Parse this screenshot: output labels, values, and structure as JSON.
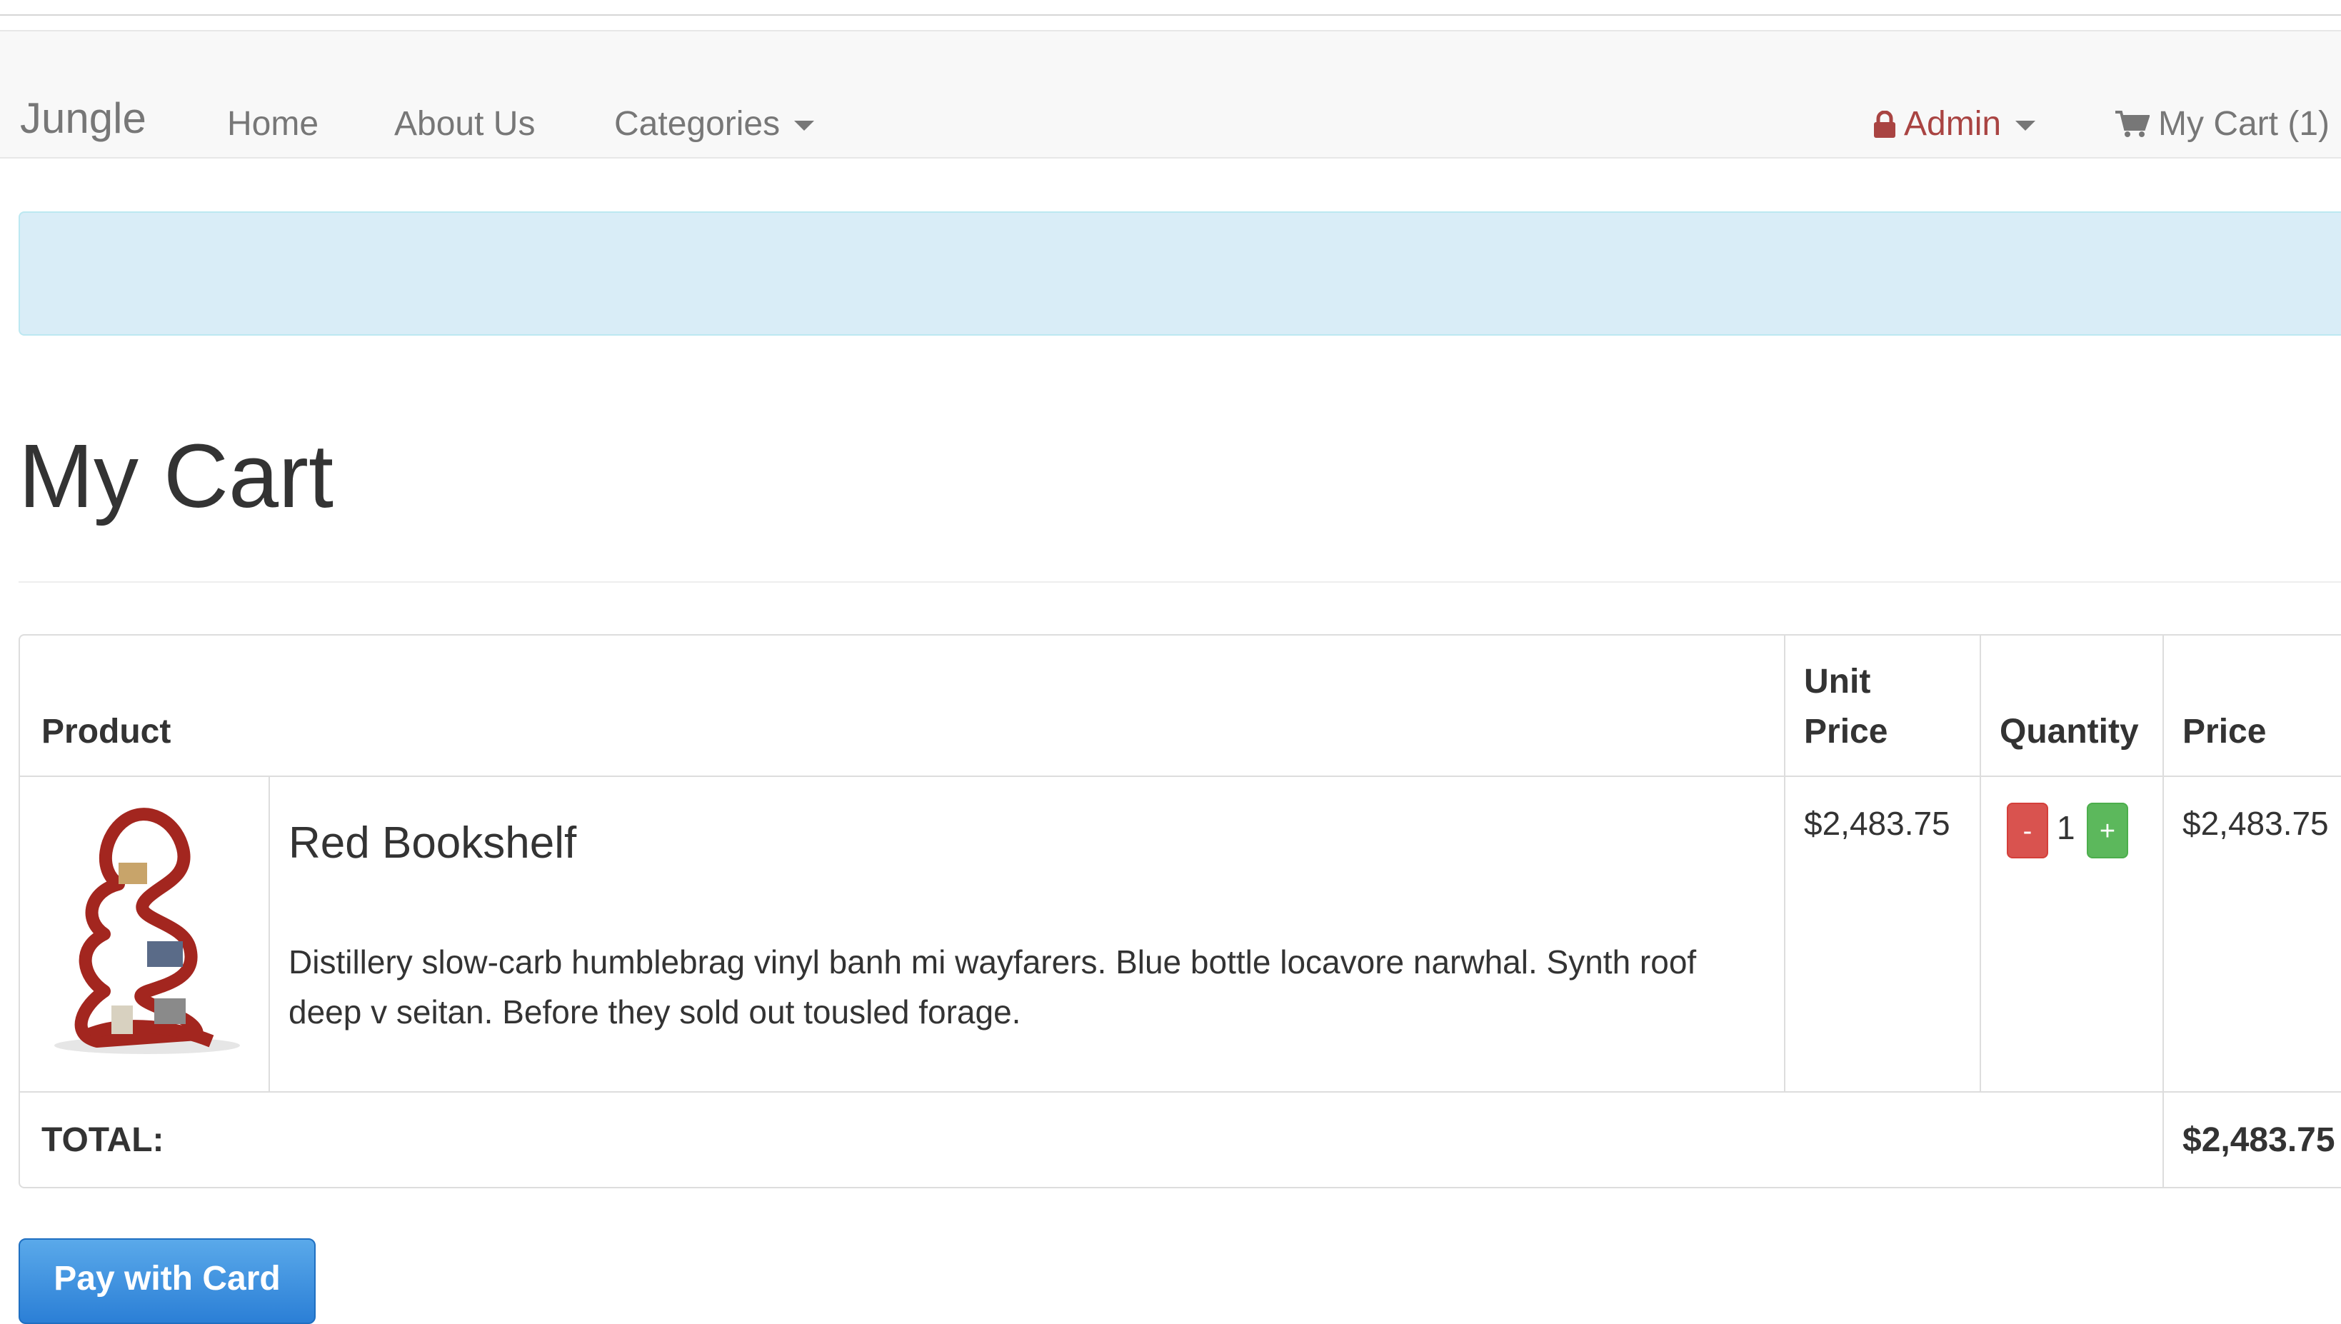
{
  "top_strip": {
    "text": "",
    "link": ""
  },
  "navbar": {
    "brand": "Jungle",
    "links": [
      "Home",
      "About Us",
      "Categories"
    ],
    "admin_label": "Admin",
    "cart_label": "My Cart (1)"
  },
  "alert": {
    "text": ""
  },
  "page_title": "My Cart",
  "table": {
    "headers": {
      "product": "Product",
      "unit_price": "Unit\nPrice",
      "quantity": "Quantity",
      "price": "Price"
    },
    "rows": [
      {
        "name": "Red Bookshelf",
        "description": "Distillery slow-carb humblebrag vinyl banh mi wayfarers. Blue bottle locavore narwhal. Synth roof deep v seitan. Before they sold out tousled forage.",
        "unit_price": "$2,483.75",
        "quantity": "1",
        "minus_label": "-",
        "plus_label": "+",
        "price": "$2,483.75"
      }
    ],
    "total_label": "TOTAL:",
    "total_value": "$2,483.75"
  },
  "pay_button": "Pay with Card",
  "colors": {
    "navbar_bg": "#f8f8f8",
    "admin_red": "#a94442",
    "alert_bg": "#d9edf7",
    "minus_btn": "#d9534f",
    "plus_btn": "#5cb85c",
    "pay_btn": "#337ab7"
  },
  "icons": [
    "lock-icon",
    "cart-icon",
    "caret-down-icon"
  ]
}
